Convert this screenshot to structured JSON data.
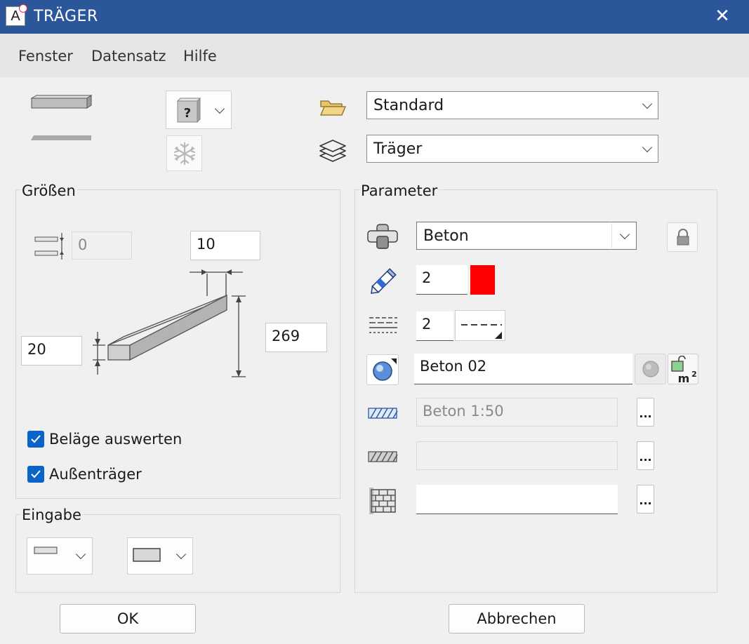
{
  "window": {
    "title": "TRÄGER",
    "app_icon_letter": "A",
    "close_symbol": "✕"
  },
  "menu": [
    "Fenster",
    "Datensatz",
    "Hilfe"
  ],
  "top": {
    "folder_combo": "Standard",
    "layer_combo": "Träger"
  },
  "groessen": {
    "label": "Größen",
    "offset_value": "0",
    "width_value": "10",
    "height_left_value": "20",
    "length_value": "269",
    "checkbox1": {
      "label": "Beläge auswerten",
      "checked": true
    },
    "checkbox2": {
      "label": "Außenträger",
      "checked": true
    }
  },
  "eingabe": {
    "label": "Eingabe"
  },
  "parameter": {
    "label": "Parameter",
    "material": "Beton",
    "pen_value": "2",
    "pen_color": "#ff0000",
    "linetype_value": "2",
    "surface": "Beton 02",
    "hatch1": "Beton 1:50",
    "hatch2": "",
    "pattern": "",
    "more_label": "...",
    "m2_label": "m",
    "m2_sup": "2"
  },
  "buttons": {
    "ok": "OK",
    "cancel": "Abbrechen"
  },
  "icons": [
    "app-icon",
    "close-icon",
    "beam-3d-icon",
    "beam-2d-icon",
    "help-icon",
    "snowflake-icon",
    "folder-icon",
    "layers-icon",
    "offset-icon",
    "beam-diagram",
    "material-icon",
    "lock-icon",
    "pen-icon",
    "linetype-icon",
    "surface-icon",
    "surface-disabled-icon",
    "m2-lock-icon",
    "hatch-blue-icon",
    "hatch-gray-icon",
    "brick-pattern-icon"
  ]
}
